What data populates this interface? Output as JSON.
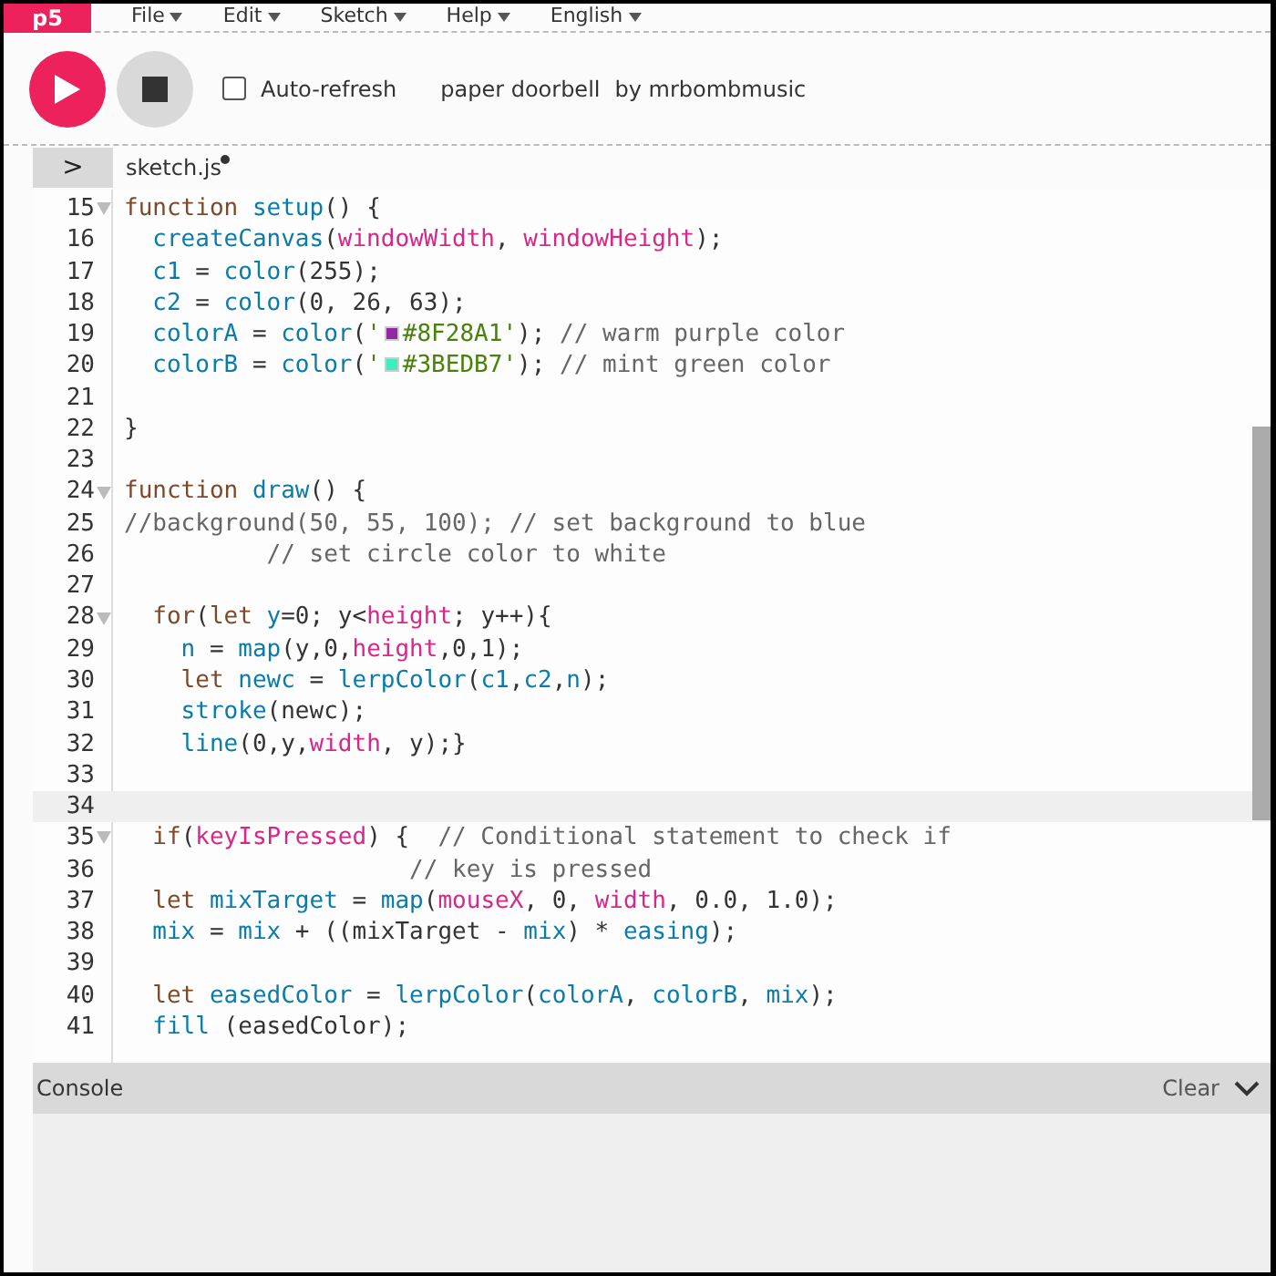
{
  "logo": "p5",
  "menu": [
    {
      "label": "File"
    },
    {
      "label": "Edit"
    },
    {
      "label": "Sketch"
    },
    {
      "label": "Help"
    },
    {
      "label": "English"
    }
  ],
  "toolbar": {
    "auto_refresh": {
      "label": "Auto-refresh",
      "checked": false
    },
    "sketch_name": "paper doorbell",
    "author": "by mrbombmusic"
  },
  "file_tab": {
    "toggle": ">",
    "name": "sketch.js",
    "unsaved": true
  },
  "code_lines": [
    {
      "number": "15",
      "foldable": true,
      "active": false,
      "tokens": [
        {
          "kind": "kw",
          "text": "function"
        },
        {
          "kind": "fn",
          "text": " setup"
        },
        {
          "kind": "p",
          "text": "() {"
        }
      ]
    },
    {
      "number": "16",
      "foldable": false,
      "active": false,
      "tokens": [
        {
          "kind": "fn",
          "text": "  createCanvas"
        },
        {
          "kind": "p",
          "text": "("
        },
        {
          "kind": "at",
          "text": "windowWidth"
        },
        {
          "kind": "p",
          "text": ", "
        },
        {
          "kind": "at",
          "text": "windowHeight"
        },
        {
          "kind": "p",
          "text": ");"
        }
      ]
    },
    {
      "number": "17",
      "foldable": false,
      "active": false,
      "tokens": [
        {
          "kind": "fn",
          "text": "  c1"
        },
        {
          "kind": "p",
          "text": " = "
        },
        {
          "kind": "fn",
          "text": "color"
        },
        {
          "kind": "p",
          "text": "(255);"
        }
      ]
    },
    {
      "number": "18",
      "foldable": false,
      "active": false,
      "tokens": [
        {
          "kind": "fn",
          "text": "  c2"
        },
        {
          "kind": "p",
          "text": " = "
        },
        {
          "kind": "fn",
          "text": "color"
        },
        {
          "kind": "p",
          "text": "(0, 26, 63);"
        }
      ]
    },
    {
      "number": "19",
      "foldable": false,
      "active": false,
      "tokens": [
        {
          "kind": "fn",
          "text": "  colorA"
        },
        {
          "kind": "p",
          "text": " = "
        },
        {
          "kind": "fn",
          "text": "color"
        },
        {
          "kind": "p",
          "text": "("
        },
        {
          "kind": "str",
          "text": "'"
        },
        {
          "kind": "swatch",
          "color": "#8f28a1"
        },
        {
          "kind": "str",
          "text": "#8F28A1'"
        },
        {
          "kind": "p",
          "text": "); "
        },
        {
          "kind": "cm",
          "text": "// warm purple color"
        }
      ]
    },
    {
      "number": "20",
      "foldable": false,
      "active": false,
      "tokens": [
        {
          "kind": "fn",
          "text": "  colorB"
        },
        {
          "kind": "p",
          "text": " = "
        },
        {
          "kind": "fn",
          "text": "color"
        },
        {
          "kind": "p",
          "text": "("
        },
        {
          "kind": "str",
          "text": "'"
        },
        {
          "kind": "swatch",
          "color": "#3bedb7"
        },
        {
          "kind": "str",
          "text": "#3BEDB7'"
        },
        {
          "kind": "p",
          "text": "); "
        },
        {
          "kind": "cm",
          "text": "// mint green color"
        }
      ]
    },
    {
      "number": "21",
      "foldable": false,
      "active": false
    },
    {
      "number": "22",
      "foldable": false,
      "active": false,
      "tokens": [
        {
          "kind": "p",
          "text": "}"
        }
      ]
    },
    {
      "number": "23",
      "foldable": false,
      "active": false
    },
    {
      "number": "24",
      "foldable": true,
      "active": false,
      "tokens": [
        {
          "kind": "kw",
          "text": "function"
        },
        {
          "kind": "fn",
          "text": " draw"
        },
        {
          "kind": "p",
          "text": "() {"
        }
      ]
    },
    {
      "number": "25",
      "foldable": false,
      "active": false,
      "tokens": [
        {
          "kind": "cm",
          "text": "//background(50, 55, 100); // set background to blue"
        }
      ]
    },
    {
      "number": "26",
      "foldable": false,
      "active": false,
      "tokens": [
        {
          "kind": "cm",
          "text": "          // set circle color to white"
        }
      ]
    },
    {
      "number": "27",
      "foldable": false,
      "active": false
    },
    {
      "number": "28",
      "foldable": true,
      "active": false,
      "tokens": [
        {
          "kind": "kw",
          "text": "  for"
        },
        {
          "kind": "p",
          "text": "("
        },
        {
          "kind": "kw",
          "text": "let"
        },
        {
          "kind": "fn",
          "text": " y"
        },
        {
          "kind": "p",
          "text": "=0; y<"
        },
        {
          "kind": "at",
          "text": "height"
        },
        {
          "kind": "p",
          "text": "; y++){"
        }
      ]
    },
    {
      "number": "29",
      "foldable": false,
      "active": false,
      "tokens": [
        {
          "kind": "fn",
          "text": "    n"
        },
        {
          "kind": "p",
          "text": " = "
        },
        {
          "kind": "fn",
          "text": "map"
        },
        {
          "kind": "p",
          "text": "(y,0,"
        },
        {
          "kind": "at",
          "text": "height"
        },
        {
          "kind": "p",
          "text": ",0,1);"
        }
      ]
    },
    {
      "number": "30",
      "foldable": false,
      "active": false,
      "tokens": [
        {
          "kind": "kw",
          "text": "    let"
        },
        {
          "kind": "fn",
          "text": " newc"
        },
        {
          "kind": "p",
          "text": " = "
        },
        {
          "kind": "fn",
          "text": "lerpColor"
        },
        {
          "kind": "p",
          "text": "("
        },
        {
          "kind": "fn",
          "text": "c1"
        },
        {
          "kind": "p",
          "text": ","
        },
        {
          "kind": "fn",
          "text": "c2"
        },
        {
          "kind": "p",
          "text": ","
        },
        {
          "kind": "fn",
          "text": "n"
        },
        {
          "kind": "p",
          "text": ");"
        }
      ]
    },
    {
      "number": "31",
      "foldable": false,
      "active": false,
      "tokens": [
        {
          "kind": "fn",
          "text": "    stroke"
        },
        {
          "kind": "p",
          "text": "(newc);"
        }
      ]
    },
    {
      "number": "32",
      "foldable": false,
      "active": false,
      "tokens": [
        {
          "kind": "fn",
          "text": "    line"
        },
        {
          "kind": "p",
          "text": "(0,y,"
        },
        {
          "kind": "at",
          "text": "width"
        },
        {
          "kind": "p",
          "text": ", y);}"
        }
      ]
    },
    {
      "number": "33",
      "foldable": false,
      "active": false
    },
    {
      "number": "34",
      "foldable": false,
      "active": true
    },
    {
      "number": "35",
      "foldable": true,
      "active": false,
      "tokens": [
        {
          "kind": "kw",
          "text": "  if"
        },
        {
          "kind": "p",
          "text": "("
        },
        {
          "kind": "at",
          "text": "keyIsPressed"
        },
        {
          "kind": "p",
          "text": ") {  "
        },
        {
          "kind": "cm",
          "text": "// Conditional statement to check if"
        }
      ]
    },
    {
      "number": "36",
      "foldable": false,
      "active": false,
      "tokens": [
        {
          "kind": "cm",
          "text": "                    // key is pressed"
        }
      ]
    },
    {
      "number": "37",
      "foldable": false,
      "active": false,
      "tokens": [
        {
          "kind": "kw",
          "text": "  let"
        },
        {
          "kind": "fn",
          "text": " mixTarget"
        },
        {
          "kind": "p",
          "text": " = "
        },
        {
          "kind": "fn",
          "text": "map"
        },
        {
          "kind": "p",
          "text": "("
        },
        {
          "kind": "at",
          "text": "mouseX"
        },
        {
          "kind": "p",
          "text": ", 0, "
        },
        {
          "kind": "at",
          "text": "width"
        },
        {
          "kind": "p",
          "text": ", 0.0, 1.0);"
        }
      ]
    },
    {
      "number": "38",
      "foldable": false,
      "active": false,
      "tokens": [
        {
          "kind": "fn",
          "text": "  mix"
        },
        {
          "kind": "p",
          "text": " = "
        },
        {
          "kind": "fn",
          "text": "mix"
        },
        {
          "kind": "p",
          "text": " + ((mixTarget - "
        },
        {
          "kind": "fn",
          "text": "mix"
        },
        {
          "kind": "p",
          "text": ") * "
        },
        {
          "kind": "fn",
          "text": "easing"
        },
        {
          "kind": "p",
          "text": ");"
        }
      ]
    },
    {
      "number": "39",
      "foldable": false,
      "active": false
    },
    {
      "number": "40",
      "foldable": false,
      "active": false,
      "tokens": [
        {
          "kind": "kw",
          "text": "  let"
        },
        {
          "kind": "fn",
          "text": " easedColor"
        },
        {
          "kind": "p",
          "text": " = "
        },
        {
          "kind": "fn",
          "text": "lerpColor"
        },
        {
          "kind": "p",
          "text": "("
        },
        {
          "kind": "fn",
          "text": "colorA"
        },
        {
          "kind": "p",
          "text": ", "
        },
        {
          "kind": "fn",
          "text": "colorB"
        },
        {
          "kind": "p",
          "text": ", "
        },
        {
          "kind": "fn",
          "text": "mix"
        },
        {
          "kind": "p",
          "text": ");"
        }
      ]
    },
    {
      "number": "41",
      "foldable": false,
      "active": false,
      "tokens": [
        {
          "kind": "fn",
          "text": "  fill"
        },
        {
          "kind": "p",
          "text": " (easedColor);"
        }
      ]
    }
  ],
  "console": {
    "title": "Console",
    "clear": "Clear"
  }
}
